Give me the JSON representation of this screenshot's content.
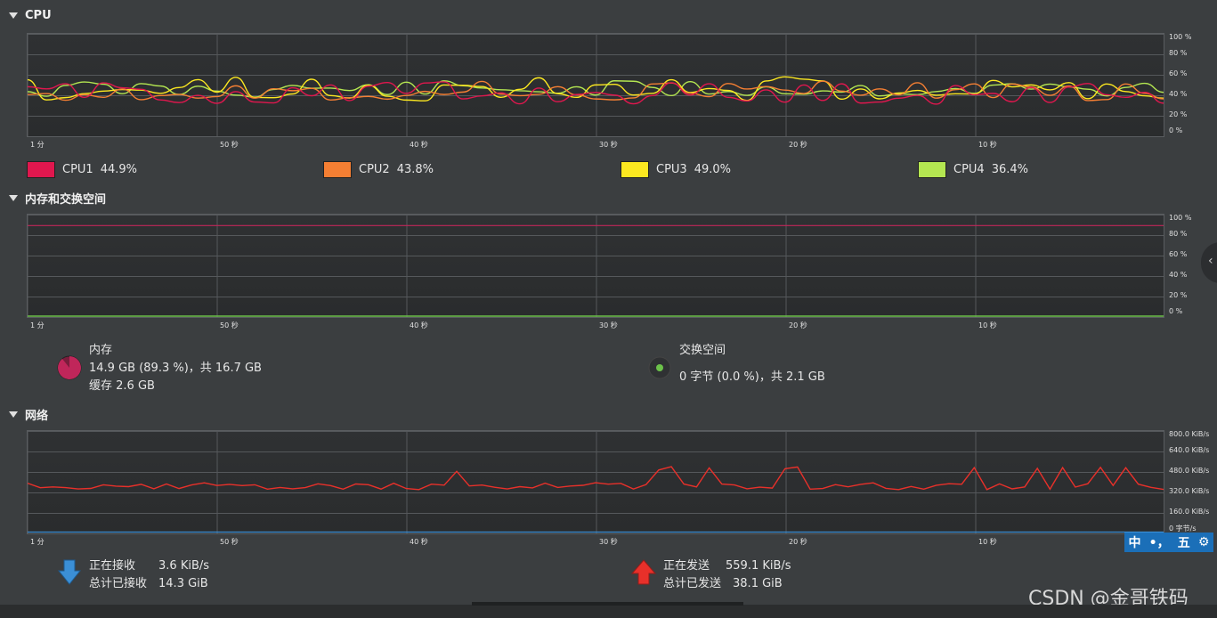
{
  "sections": {
    "cpu_title": "CPU",
    "memory_title": "内存和交换空间",
    "network_title": "网络"
  },
  "time_axis": [
    "1 分",
    "50 秒",
    "40 秒",
    "30 秒",
    "20 秒",
    "10 秒"
  ],
  "cpu_axis": [
    "100 %",
    "80 %",
    "60 %",
    "40 %",
    "20 %",
    "0 %"
  ],
  "mem_axis": [
    "100 %",
    "80 %",
    "60 %",
    "40 %",
    "20 %",
    "0 %"
  ],
  "net_axis": [
    "800.0 KiB/s",
    "640.0 KiB/s",
    "480.0 KiB/s",
    "320.0 KiB/s",
    "160.0 KiB/s",
    "0 字节/s"
  ],
  "cpu_legend": [
    {
      "name": "CPU1",
      "value": "44.9%",
      "color": "#e0174e"
    },
    {
      "name": "CPU2",
      "value": "43.8%",
      "color": "#f57f33"
    },
    {
      "name": "CPU3",
      "value": "49.0%",
      "color": "#fce820"
    },
    {
      "name": "CPU4",
      "value": "36.4%",
      "color": "#b4e651"
    }
  ],
  "memory": {
    "label": "内存",
    "usage": "14.9 GB (89.3 %)，共 16.7 GB",
    "cache": "缓存 2.6 GB",
    "percent": 89.3,
    "color": "#c0265a"
  },
  "swap": {
    "label": "交换空间",
    "usage": "0 字节 (0.0 %)，共 2.1 GB",
    "percent": 0.0,
    "color": "#6cc24a"
  },
  "network": {
    "receiving_label": "正在接收",
    "receiving_value": "3.6 KiB/s",
    "total_received_label": "总计已接收",
    "total_received_value": "14.3 GiB",
    "sending_label": "正在发送",
    "sending_value": "559.1 KiB/s",
    "total_sent_label": "总计已发送",
    "total_sent_value": "38.1 GiB",
    "recv_color": "#3b8fd6",
    "send_color": "#e8302a"
  },
  "ime": {
    "lang": "中",
    "punct": "•，",
    "mode": "五",
    "settings_icon": "gear-icon"
  },
  "watermark": "CSDN @金哥铁码"
}
